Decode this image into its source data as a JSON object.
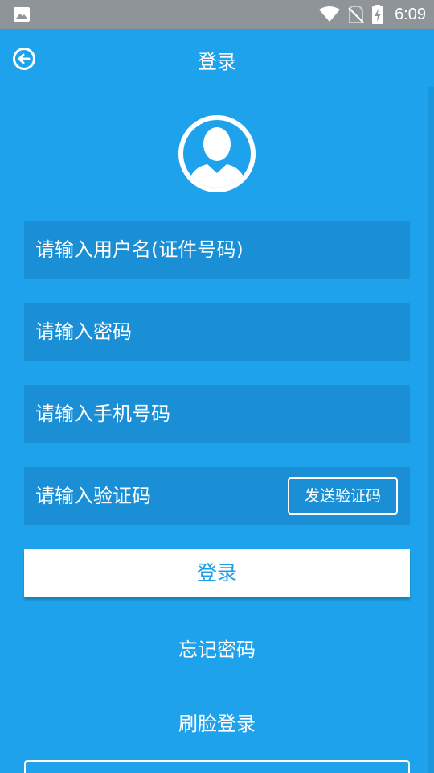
{
  "statusbar": {
    "time": "6:09",
    "left_icon": "image-icon",
    "icons": [
      "wifi-icon",
      "no-sim-icon",
      "battery-charging-icon"
    ]
  },
  "appbar": {
    "title": "登录",
    "back_icon": "back-arrow-icon"
  },
  "avatar": {
    "icon": "user-silhouette-icon"
  },
  "form": {
    "username_placeholder": "请输入用户名(证件号码)",
    "password_placeholder": "请输入密码",
    "phone_placeholder": "请输入手机号码",
    "code_placeholder": "请输入验证码",
    "send_code_label": "发送验证码"
  },
  "actions": {
    "login_label": "登录",
    "forgot_password_label": "忘记密码",
    "face_login_label": "刷脸登录"
  },
  "colors": {
    "background": "#1da2eb",
    "field": "#1a8fd6",
    "statusbar": "#8f9498",
    "login_text": "#1d9fe8"
  }
}
